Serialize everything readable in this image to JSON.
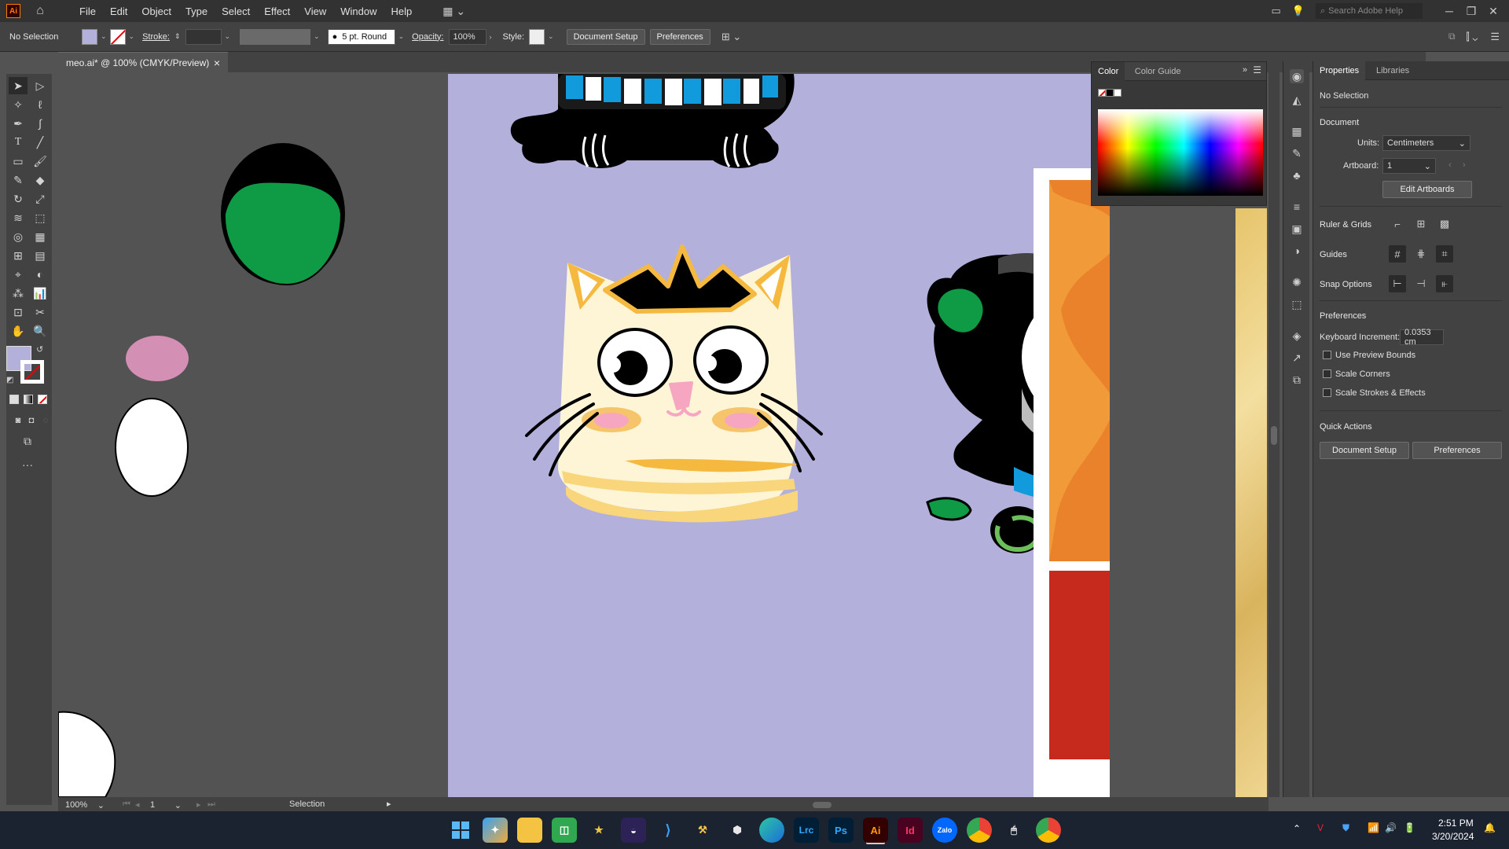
{
  "app": {
    "logo": "Ai",
    "window_controls": [
      "─",
      "❐",
      "✕"
    ]
  },
  "menu": [
    "File",
    "Edit",
    "Object",
    "Type",
    "Select",
    "Effect",
    "View",
    "Window",
    "Help"
  ],
  "search": {
    "placeholder": "Search Adobe Help"
  },
  "control_bar": {
    "selection": "No Selection",
    "stroke_label": "Stroke:",
    "brush": "5 pt. Round",
    "opacity_label": "Opacity:",
    "opacity_value": "100%",
    "style_label": "Style:",
    "document_setup": "Document Setup",
    "preferences": "Preferences"
  },
  "doc_tab": {
    "title": "meo.ai* @ 100% (CMYK/Preview)",
    "close": "×"
  },
  "color_panel": {
    "tabs": [
      "Color",
      "Color Guide"
    ]
  },
  "properties": {
    "tabs": [
      "Properties",
      "Libraries"
    ],
    "selection": "No Selection",
    "document_header": "Document",
    "units_label": "Units:",
    "units_value": "Centimeters",
    "artboard_label": "Artboard:",
    "artboard_value": "1",
    "edit_artboards": "Edit Artboards",
    "ruler_grids": "Ruler & Grids",
    "guides": "Guides",
    "snap_options": "Snap Options",
    "preferences_header": "Preferences",
    "keyboard_increment_label": "Keyboard Increment:",
    "keyboard_increment_value": "0.0353 cm",
    "use_preview_bounds": "Use Preview Bounds",
    "scale_corners": "Scale Corners",
    "scale_strokes": "Scale Strokes & Effects",
    "quick_actions": "Quick Actions",
    "document_setup": "Document Setup",
    "preferences": "Preferences"
  },
  "status_bar": {
    "zoom": "100%",
    "artboard": "1",
    "tool": "Selection"
  },
  "taskbar": {
    "apps": [
      "Lrc",
      "Ps",
      "Ai",
      "Id",
      "Zalo"
    ],
    "time": "2:51 PM",
    "date": "3/20/2024"
  },
  "colors": {
    "artboard": "#b3b0dc",
    "fill_swatch": "#b3b0dc",
    "accent": "#ff7c00"
  }
}
